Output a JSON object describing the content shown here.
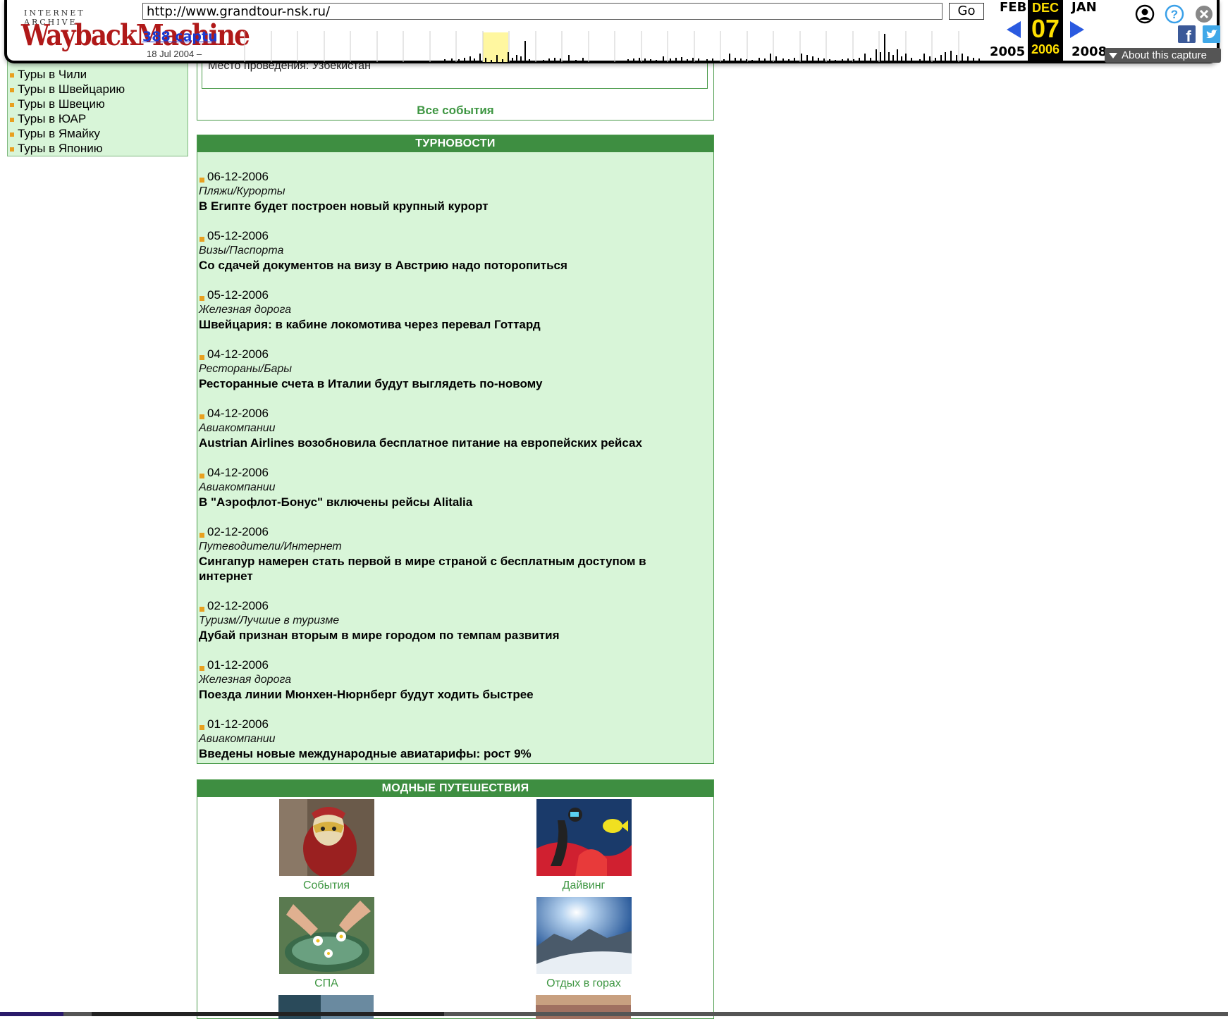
{
  "wayback": {
    "logo_top": "INTERNET ARCHIVE",
    "logo_main": "WaybackMachine",
    "url": "http://www.grandtour-nsk.ru/",
    "go_label": "Go",
    "captures_link": "388 captur",
    "range_text": "18 Jul 2004 – ",
    "prev_month": "FEB",
    "cur_month": "DEC",
    "next_month": "JAN",
    "prev_year": "2005",
    "cur_day": "07",
    "cur_year": "2006",
    "next_year": "2008",
    "about_label": "About this capture",
    "icons": [
      "user-icon",
      "help-icon",
      "close-icon",
      "facebook-icon",
      "twitter-icon"
    ],
    "accent_color": "#ffdf00"
  },
  "sidebar": {
    "items": [
      "Туры в Чили",
      "Туры в Швейцарию",
      "Туры в Швецию",
      "Туры в ЮАР",
      "Туры в Ямайку",
      "Туры в Японию"
    ]
  },
  "events": {
    "location": "Место проведения: Узбекистан",
    "all_link": "Все события"
  },
  "news": {
    "header": "ТУРНОВОСТИ",
    "items": [
      {
        "date": "06-12-2006",
        "category": "Пляжи/Курорты",
        "title": "В Египте будет построен новый крупный курорт"
      },
      {
        "date": "05-12-2006",
        "category": "Визы/Паспорта",
        "title": "Со сдачей документов на визу в Австрию надо поторопиться"
      },
      {
        "date": "05-12-2006",
        "category": "Железная дорога",
        "title": "Швейцария: в кабине локомотива через перевал Готтард"
      },
      {
        "date": "04-12-2006",
        "category": "Рестораны/Бары",
        "title": "Ресторанные счета в Италии будут выглядеть по-новому"
      },
      {
        "date": "04-12-2006",
        "category": "Авиакомпании",
        "title": "Austrian Airlines возобновила бесплатное питание на европейских рейсах"
      },
      {
        "date": "04-12-2006",
        "category": "Авиакомпании",
        "title": "В \"Аэрофлот-Бонус\" включены рейсы Alitalia"
      },
      {
        "date": "02-12-2006",
        "category": "Путеводители/Интернет",
        "title": "Сингапур намерен стать первой в мире страной с бесплатным доступом в интернет"
      },
      {
        "date": "02-12-2006",
        "category": "Туризм/Лучшие в туризме",
        "title": "Дубай признан вторым в мире городом по темпам развития"
      },
      {
        "date": "01-12-2006",
        "category": "Железная дорога",
        "title": "Поезда линии Мюнхен-Нюрнберг будут ходить быстрее"
      },
      {
        "date": "01-12-2006",
        "category": "Авиакомпании",
        "title": "Введены новые международные авиатарифы: рост 9%"
      }
    ]
  },
  "fashion": {
    "header": "МОДНЫЕ ПУТЕШЕСТВИЯ",
    "tiles": [
      {
        "caption": "События"
      },
      {
        "caption": "Дайвинг"
      },
      {
        "caption": "СПА"
      },
      {
        "caption": "Отдых в горах"
      }
    ]
  }
}
